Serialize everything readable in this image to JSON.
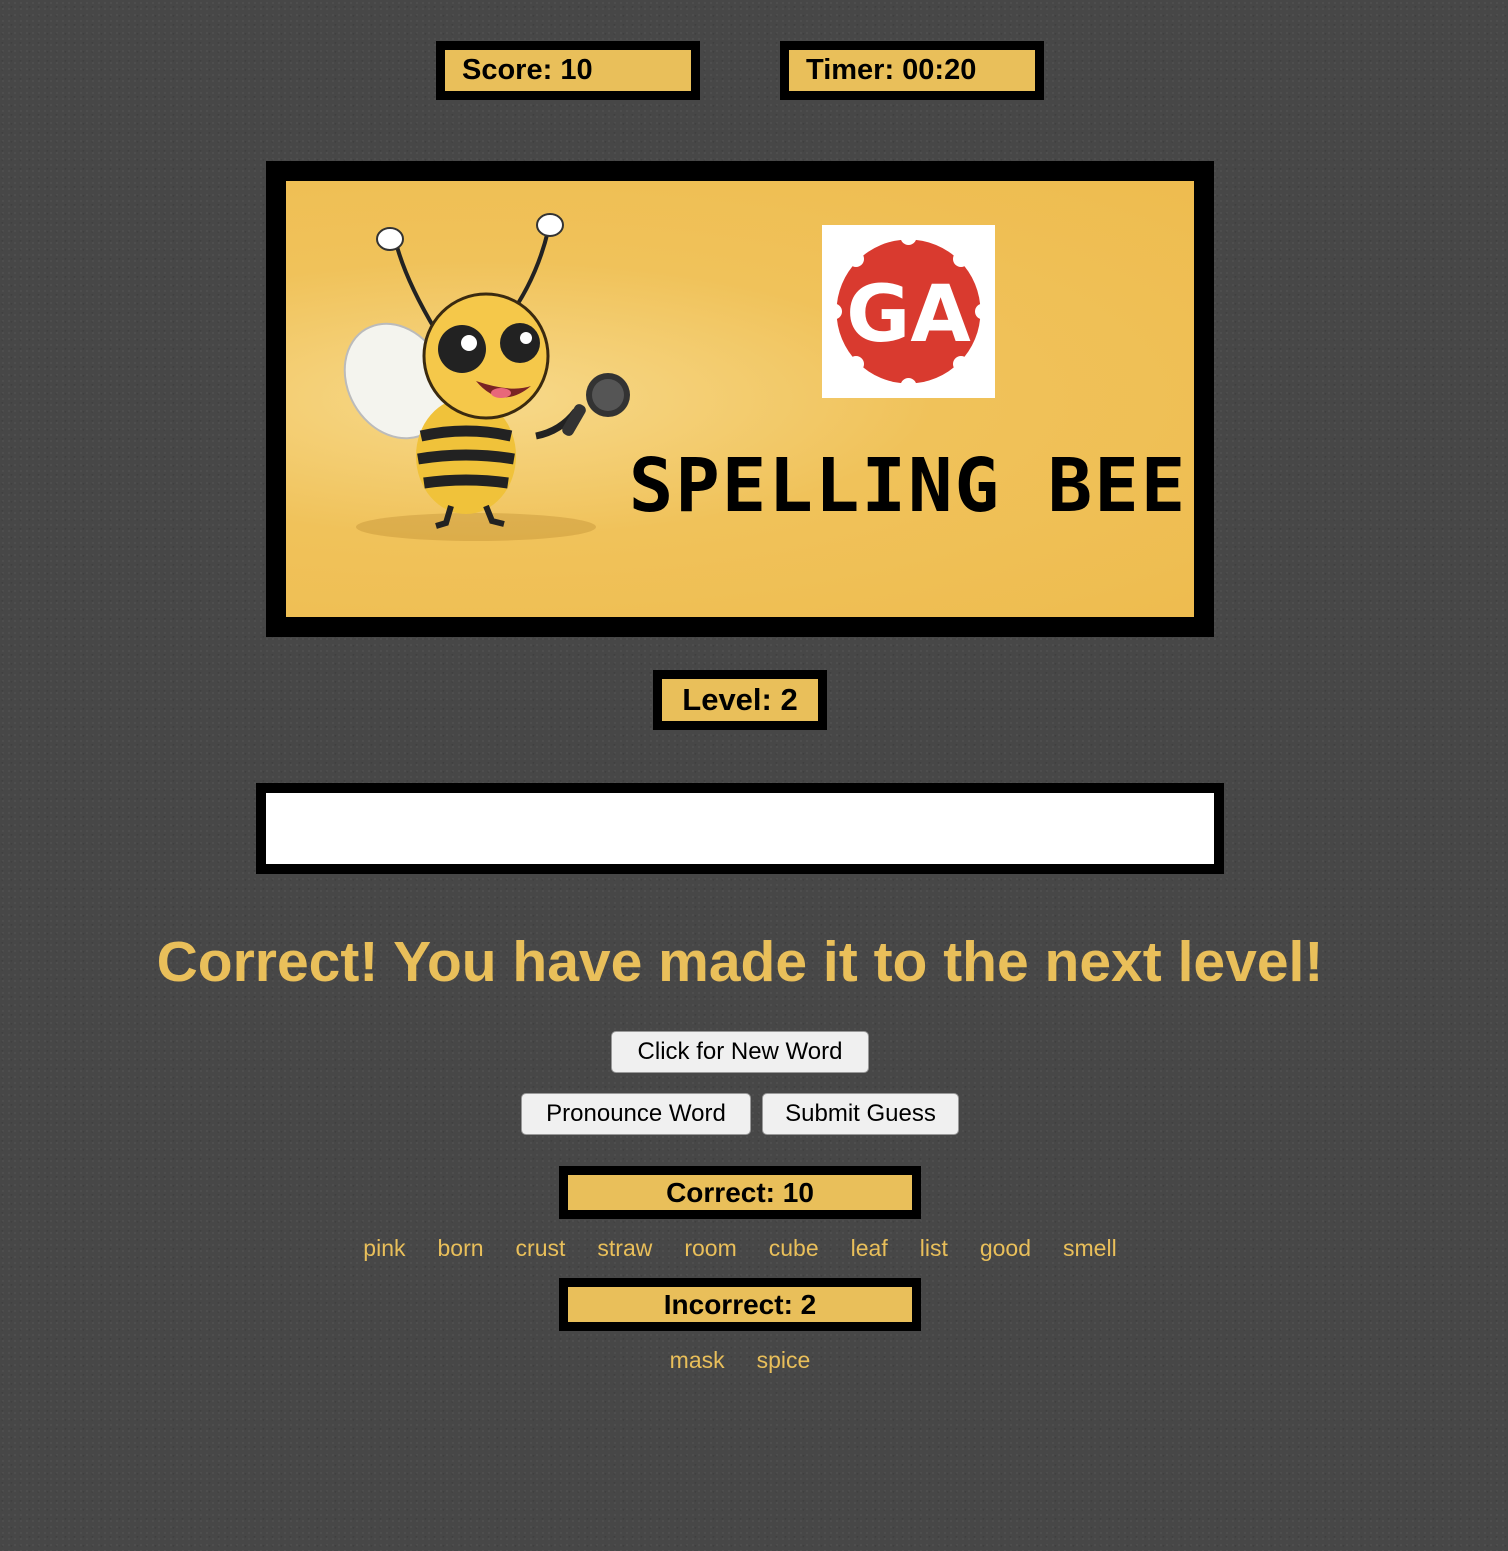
{
  "header": {
    "score_label": "Score: 10",
    "timer_label": "Timer: 00:20"
  },
  "banner": {
    "logo_text": "GA",
    "title": "SPELLING BEE",
    "colors": {
      "background": "#f0c25a",
      "logo_red": "#d93a2f"
    }
  },
  "level_label": "Level: 2",
  "guess_input": {
    "value": "",
    "placeholder": ""
  },
  "message": "Correct! You have made it to the next level!",
  "buttons": {
    "new_word": "Click for New Word",
    "pronounce": "Pronounce Word",
    "submit": "Submit Guess"
  },
  "correct": {
    "heading": "Correct: 10",
    "words": [
      "pink",
      "born",
      "crust",
      "straw",
      "room",
      "cube",
      "leaf",
      "list",
      "good",
      "smell"
    ]
  },
  "incorrect": {
    "heading": "Incorrect: 2",
    "words": [
      "mask",
      "spice"
    ]
  },
  "theme": {
    "accent": "#e9bf5a",
    "border": "#000000",
    "page_background": "#474747"
  }
}
